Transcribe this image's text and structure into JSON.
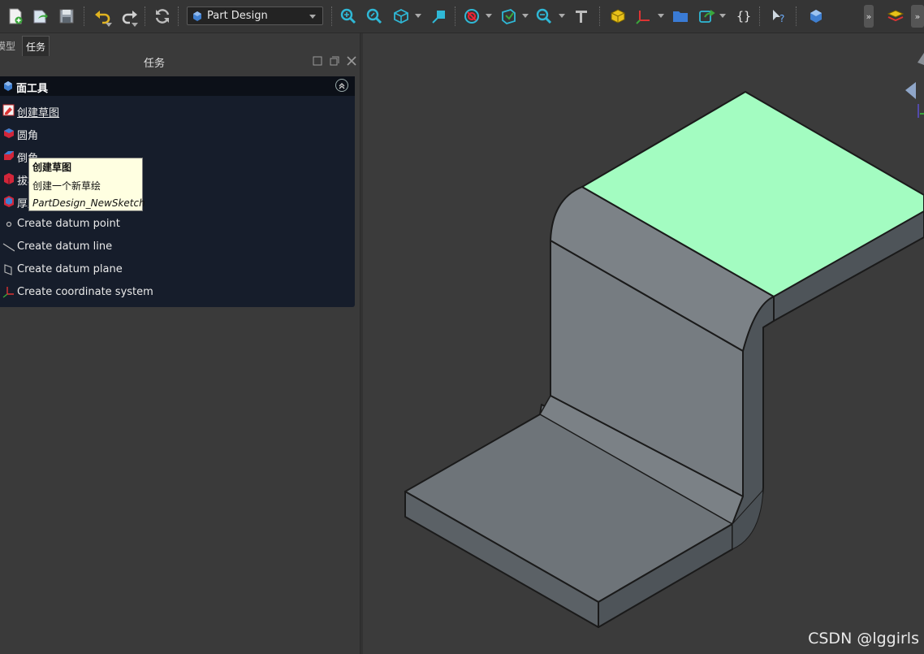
{
  "toolbar": {
    "workbench": "Part Design",
    "icons": [
      "new-file-icon",
      "open-file-icon",
      "save-icon",
      "undo-icon",
      "redo-icon",
      "refresh-icon",
      "fit-all-icon",
      "fit-selection-icon",
      "view-cube-icon",
      "sketch-view-icon",
      "draw-style-icon",
      "bounding-box-icon",
      "zoom-icon",
      "measure-icon",
      "part-icon",
      "axis-icon",
      "folder-icon",
      "link-icon",
      "macro-icon",
      "whats-this-icon",
      "body-icon",
      "layers-icon"
    ],
    "more": "»"
  },
  "panel": {
    "tab_model": "模型",
    "tab_task": "任务",
    "title": "任务",
    "taskbox_title": "面工具",
    "items": [
      {
        "label": "创建草图",
        "icon": "sketch-icon"
      },
      {
        "label": "圆角",
        "icon": "fillet-icon"
      },
      {
        "label": "倒角",
        "icon": "chamfer-icon"
      },
      {
        "label": "拔模",
        "icon": "draft-icon"
      },
      {
        "label": "厚度",
        "icon": "thickness-icon"
      },
      {
        "label": "Create datum point",
        "icon": "datum-point-icon"
      },
      {
        "label": "Create datum line",
        "icon": "datum-line-icon"
      },
      {
        "label": "Create datum plane",
        "icon": "datum-plane-icon"
      },
      {
        "label": "Create coordinate system",
        "icon": "coordinate-system-icon"
      }
    ]
  },
  "tooltip": {
    "title": "创建草图",
    "description": "创建一个新草绘",
    "command": "PartDesign_NewSketch"
  },
  "viewport": {
    "selected_face_color": "#a3fcc1",
    "body_color": "#6e7479",
    "background": "#3b3b3b"
  },
  "watermark": "CSDN @lggirls"
}
